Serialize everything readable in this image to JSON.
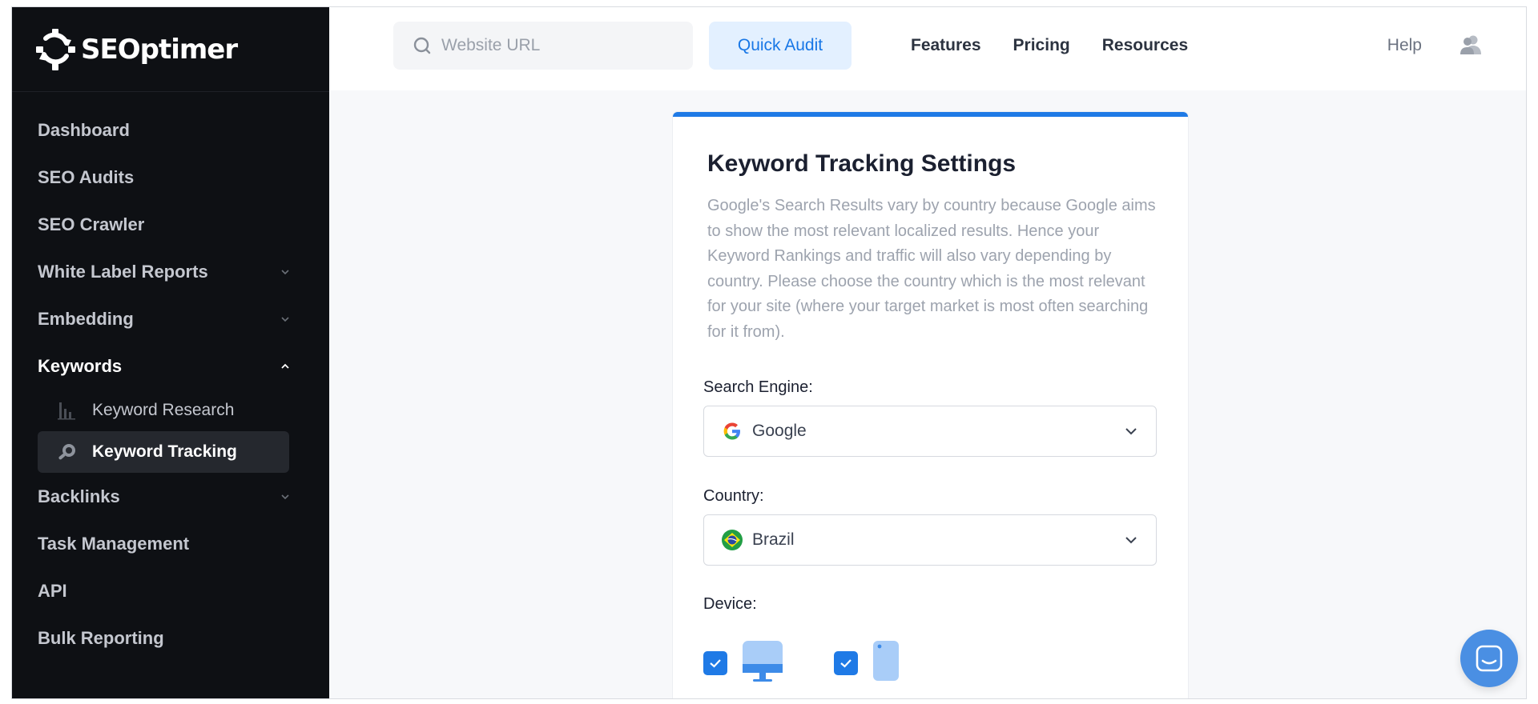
{
  "brand": {
    "name": "SEOptimer"
  },
  "sidebar": {
    "items": [
      {
        "label": "Dashboard"
      },
      {
        "label": "SEO Audits"
      },
      {
        "label": "SEO Crawler"
      },
      {
        "label": "White Label Reports"
      },
      {
        "label": "Embedding"
      },
      {
        "label": "Keywords"
      },
      {
        "label": "Backlinks"
      },
      {
        "label": "Task Management"
      },
      {
        "label": "API"
      },
      {
        "label": "Bulk Reporting"
      }
    ],
    "keywords_sub": [
      {
        "label": "Keyword Research"
      },
      {
        "label": "Keyword Tracking"
      }
    ]
  },
  "header": {
    "search_placeholder": "Website URL",
    "quick_audit": "Quick Audit",
    "nav": [
      "Features",
      "Pricing",
      "Resources"
    ],
    "help": "Help"
  },
  "card": {
    "title": "Keyword Tracking Settings",
    "description": "Google's Search Results vary by country because Google aims to show the most relevant localized results. Hence your Keyword Rankings and traffic will also vary depending by country. Please choose the country which is the most relevant for your site (where your target market is most often searching for it from).",
    "search_engine_label": "Search Engine:",
    "search_engine_value": "Google",
    "country_label": "Country:",
    "country_value": "Brazil",
    "device_label": "Device:"
  },
  "colors": {
    "accent": "#1f7ae6",
    "sidebar_bg": "#0e1014",
    "chat": "#4a8fe3"
  }
}
